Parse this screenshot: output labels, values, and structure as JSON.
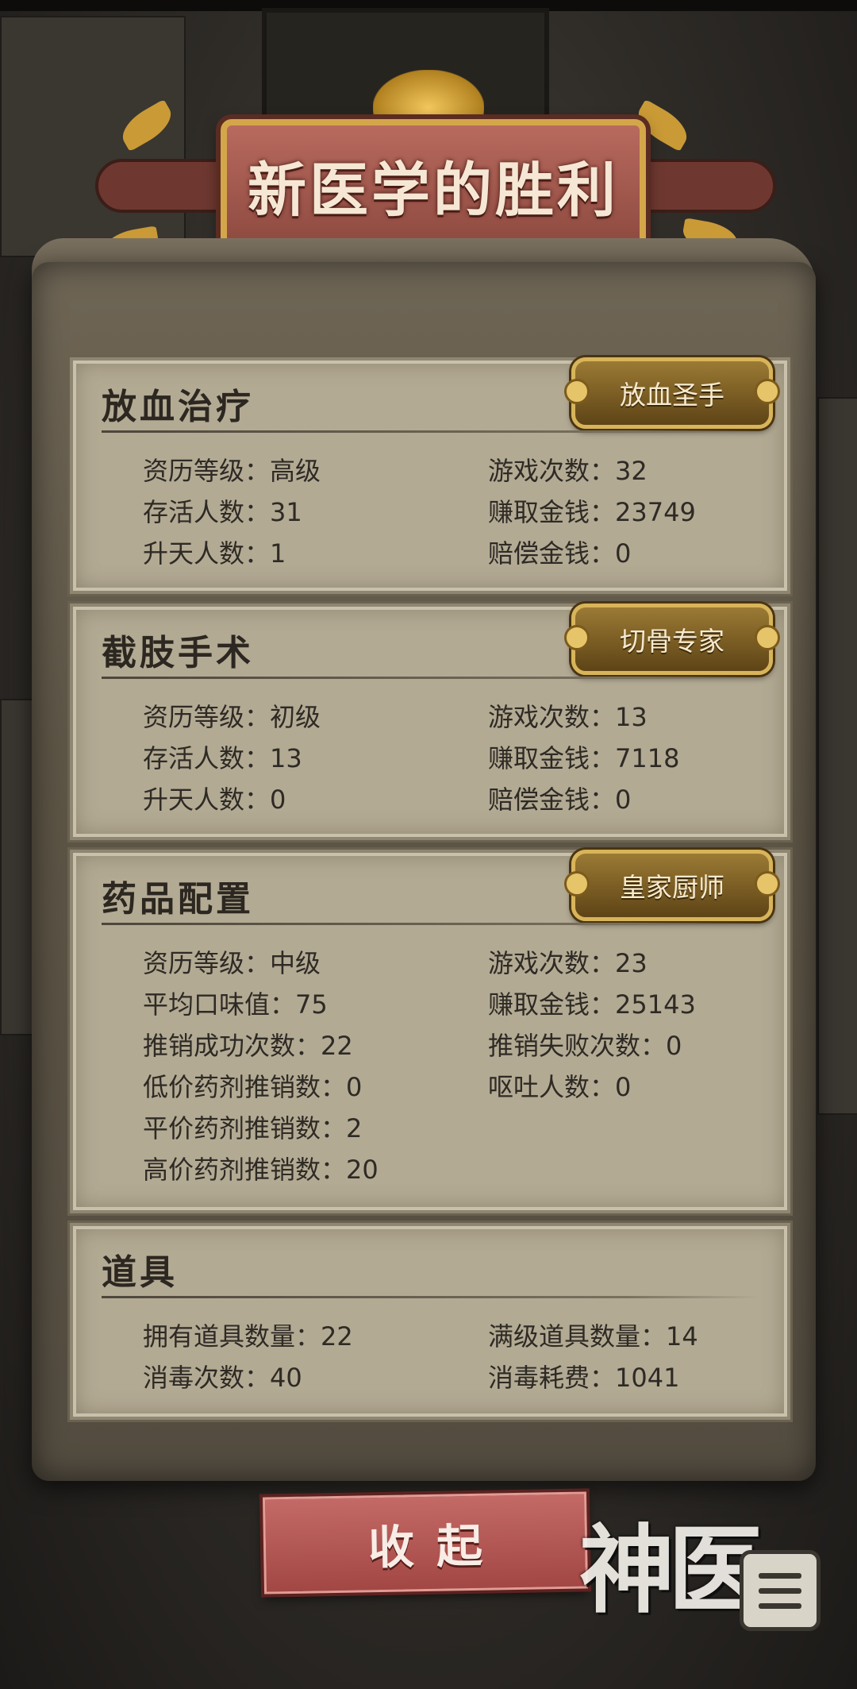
{
  "title": "新医学的胜利",
  "sections": [
    {
      "title": "放血治疗",
      "badge": "放血圣手",
      "left": [
        "资历等级：高级",
        "存活人数：31",
        "升天人数：1"
      ],
      "right": [
        "游戏次数：32",
        "赚取金钱：23749",
        "赔偿金钱：0"
      ]
    },
    {
      "title": "截肢手术",
      "badge": "切骨专家",
      "left": [
        "资历等级：初级",
        "存活人数：13",
        "升天人数：0"
      ],
      "right": [
        "游戏次数：13",
        "赚取金钱：7118",
        "赔偿金钱：0"
      ]
    },
    {
      "title": "药品配置",
      "badge": "皇家厨师",
      "left": [
        "资历等级：中级",
        "平均口味值：75",
        "推销成功次数：22",
        "低价药剂推销数：0",
        "平价药剂推销数：2",
        "高价药剂推销数：20"
      ],
      "right": [
        "游戏次数：23",
        "赚取金钱：25143",
        "推销失败次数：0",
        "呕吐人数：0"
      ]
    },
    {
      "title": "道具",
      "left": [
        "拥有道具数量：22",
        "消毒次数：40"
      ],
      "right": [
        "满级道具数量：14",
        "消毒耗费：1041"
      ]
    }
  ],
  "collapse_label": "收起",
  "logo_text": "神医",
  "icons": {
    "menu": "menu-list-icon"
  },
  "colors": {
    "panel": "#b3aa94",
    "button": "#b3504c",
    "badge_gold": "#d8b45a",
    "banner": "#a25a4f"
  }
}
